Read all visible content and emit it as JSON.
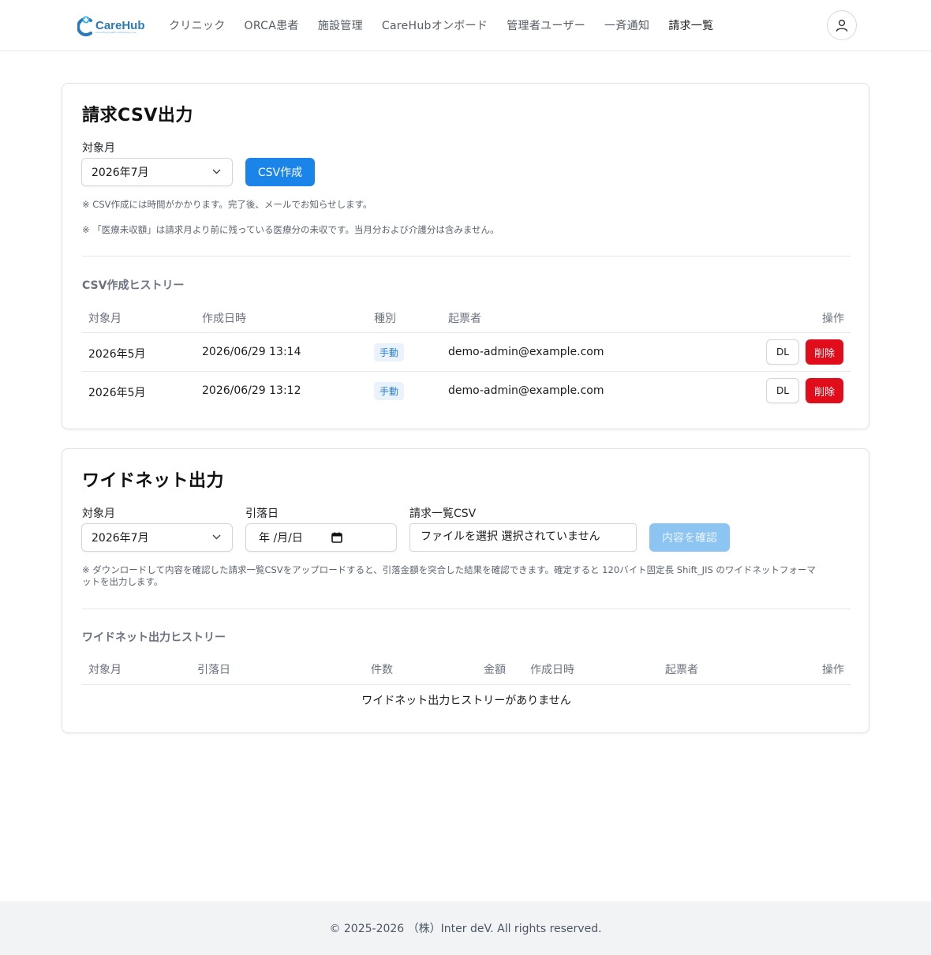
{
  "header": {
    "logo_text": "CareHub",
    "logo_tagline": "connecting health, simplifying care",
    "nav": [
      {
        "label": "クリニック"
      },
      {
        "label": "ORCA患者"
      },
      {
        "label": "施設管理"
      },
      {
        "label": "CareHubオンボード"
      },
      {
        "label": "管理者ユーザー"
      },
      {
        "label": "一斉通知"
      },
      {
        "label": "請求一覧"
      }
    ],
    "active_nav": "請求一覧",
    "user_icon": "user-icon"
  },
  "billing_csv": {
    "title": "請求CSV出力",
    "month_label": "対象月",
    "month_value": "2026年7月",
    "create_button": "CSV作成",
    "note1": "※ CSV作成には時間がかかります。完了後、メールでお知らせします。",
    "note2": "※ 「医療未収額」は請求月より前に残っている医療分の未収です。当月分および介護分は含みません。",
    "history_title": "CSV作成ヒストリー",
    "columns": [
      "対象月",
      "作成日時",
      "種別",
      "起票者",
      "操作"
    ],
    "rows": [
      {
        "month": "2026年5月",
        "created": "2026/06/29 13:14",
        "kind": "手動",
        "author": "demo-admin@example.com",
        "dl": "DL",
        "delete": "削除"
      },
      {
        "month": "2026年5月",
        "created": "2026/06/29 13:12",
        "kind": "手動",
        "author": "demo-admin@example.com",
        "dl": "DL",
        "delete": "削除"
      }
    ]
  },
  "widenet": {
    "title": "ワイドネット出力",
    "month_label": "対象月",
    "month_value": "2026年7月",
    "debit_label": "引落日",
    "debit_value": "年 /月/日",
    "csv_label": "請求一覧CSV",
    "file_text": "ファイルを選択 選択されていません",
    "confirm_button": "内容を確認",
    "note_line1": "※ ダウンロードして内容を確認した請求一覧CSVをアップロードすると、引落金額を突合した結果を確認できます。確定すると 120バイト固定長 Shift_JIS のワイドネットフォーマ",
    "note_line2": "ットを出力します。",
    "history_title": "ワイドネット出力ヒストリー",
    "columns": [
      "対象月",
      "引落日",
      "件数",
      "金額",
      "作成日時",
      "起票者",
      "操作"
    ],
    "empty_text": "ワイドネット出力ヒストリーがありません"
  },
  "footer": {
    "copyright": "© 2025-2026 （株）Inter deV. All rights reserved."
  },
  "colors": {
    "primary": "#1a84e8",
    "primary_disabled": "#8cc5f2",
    "danger": "#e10d1b",
    "brand": "#2b79b8"
  }
}
